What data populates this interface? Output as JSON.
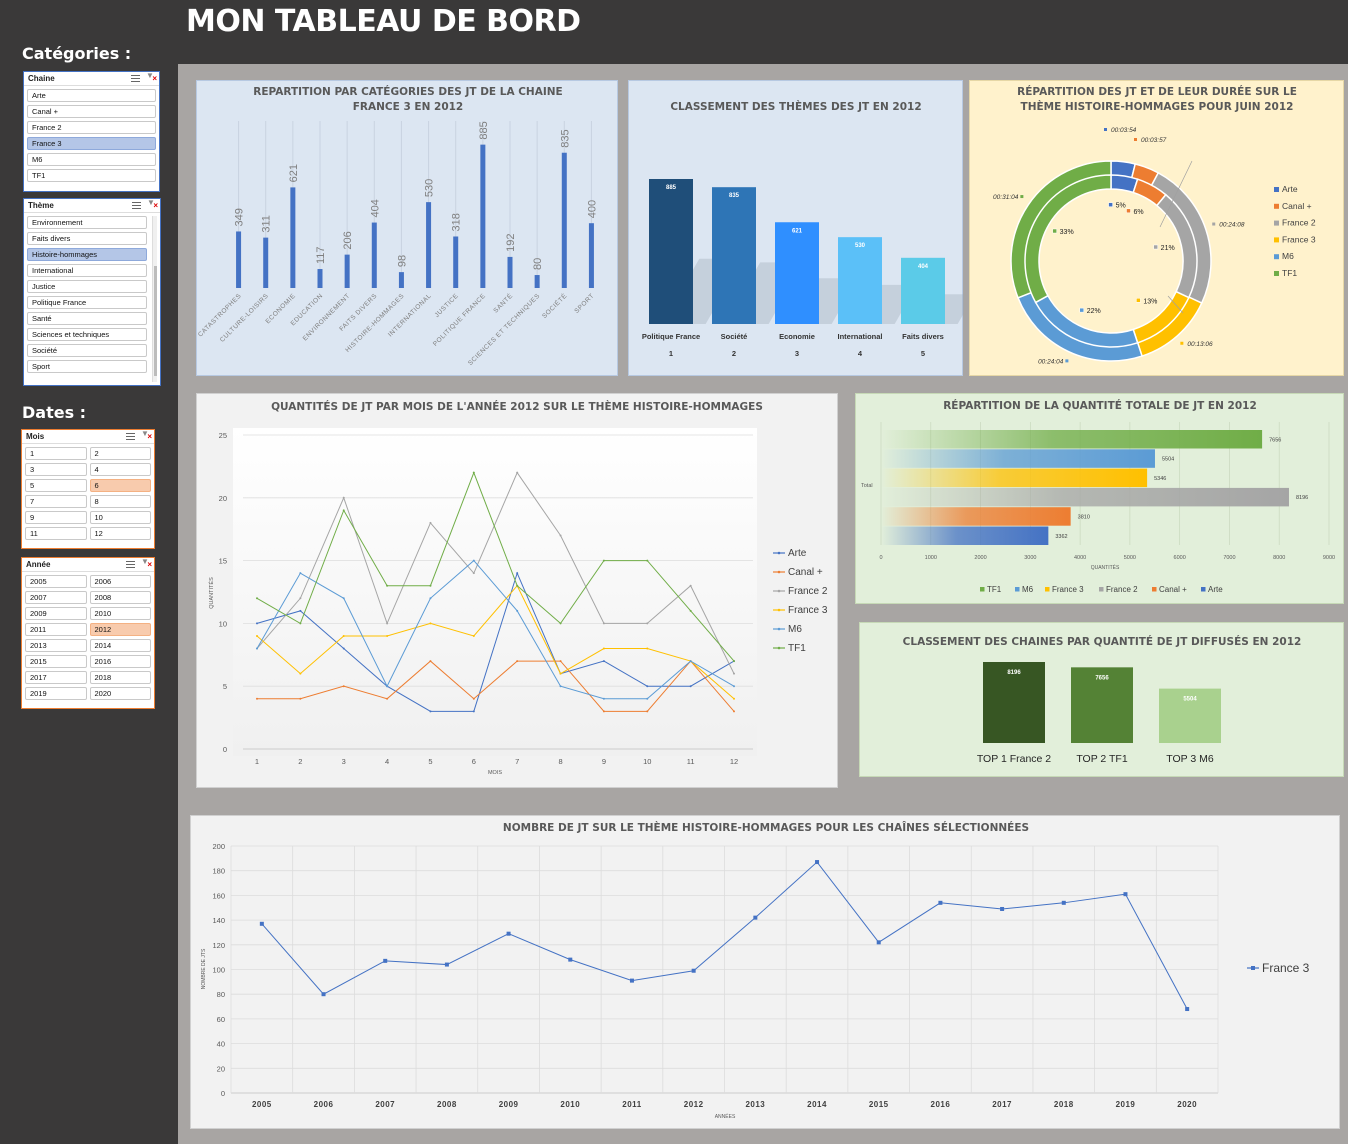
{
  "dashboard": {
    "title": "MON TABLEAU DE BORD"
  },
  "sidebar": {
    "categories_label": "Catégories :",
    "dates_label": "Dates :",
    "chaine": {
      "title": "Chaine",
      "items": [
        "Arte",
        "Canal +",
        "France 2",
        "France 3",
        "M6",
        "TF1"
      ],
      "selected": "France 3"
    },
    "theme": {
      "title": "Thème",
      "items": [
        "Environnement",
        "Faits divers",
        "Histoire-hommages",
        "International",
        "Justice",
        "Politique France",
        "Santé",
        "Sciences et techniques",
        "Société",
        "Sport"
      ],
      "selected": "Histoire-hommages"
    },
    "mois": {
      "title": "Mois",
      "items": [
        "1",
        "2",
        "3",
        "4",
        "5",
        "6",
        "7",
        "8",
        "9",
        "10",
        "11",
        "12"
      ],
      "selected": "6"
    },
    "annee": {
      "title": "Année",
      "items": [
        "2005",
        "2006",
        "2007",
        "2008",
        "2009",
        "2010",
        "2011",
        "2012",
        "2013",
        "2014",
        "2015",
        "2016",
        "2017",
        "2018",
        "2019",
        "2020"
      ],
      "selected": "2012"
    }
  },
  "colors": {
    "background": "#3a3939",
    "canvas": "#a8a5a3",
    "blue": "#4472c4",
    "orange": "#ed7d31",
    "gray": "#a5a5a5",
    "yellow": "#ffc000",
    "m6": "#5b9bd5",
    "green": "#70ad47",
    "panel_blue": "#dce6f2",
    "panel_yellow": "#fff2cc",
    "panel_green": "#e2efda"
  },
  "chart_data": [
    {
      "id": "categories",
      "type": "bar",
      "title": "REPARTITION PAR CATÉGORIES DES JT DE LA CHAINE FRANCE 3 EN 2012",
      "categories": [
        "CATASTROPHES",
        "CULTURE-LOISIRS",
        "ECONOMIE",
        "EDUCATION",
        "ENVIRONNEMENT",
        "FAITS DIVERS",
        "HISTOIRE-HOMMAGES",
        "INTERNATIONAL",
        "JUSTICE",
        "POLITIQUE FRANCE",
        "SANTÉ",
        "SCIENCES ET TECHNIQUES",
        "SOCIÉTÉ",
        "SPORT"
      ],
      "values": [
        349,
        311,
        621,
        117,
        206,
        404,
        98,
        530,
        318,
        885,
        192,
        80,
        835,
        400
      ],
      "ylim": [
        0,
        1000
      ],
      "bar_color": "#4472c4"
    },
    {
      "id": "themes_rank",
      "type": "bar",
      "title": "CLASSEMENT DES THÈMES DES JT EN 2012",
      "categories": [
        "Politique France",
        "Société",
        "Economie",
        "International",
        "Faits divers"
      ],
      "ranks": [
        "1",
        "2",
        "3",
        "4",
        "5"
      ],
      "values": [
        885,
        835,
        621,
        530,
        404
      ],
      "colors": [
        "#1f4e79",
        "#2e75b6",
        "#2f8fff",
        "#5bc0f8",
        "#5bcbe8"
      ]
    },
    {
      "id": "donut",
      "type": "pie",
      "title": "RÉPARTITION DES JT ET DE LEUR DURÉE SUR LE THÈME HISTOIRE-HOMMAGES POUR JUIN 2012",
      "legend": [
        "Arte",
        "Canal +",
        "France 2",
        "France 3",
        "M6",
        "TF1"
      ],
      "legend_position": "right",
      "colors": [
        "#4472c4",
        "#ed7d31",
        "#a5a5a5",
        "#ffc000",
        "#5b9bd5",
        "#70ad47"
      ],
      "inner_percent": [
        5,
        6,
        21,
        13,
        22,
        33
      ],
      "inner_labels": [
        "5%",
        "6%",
        "21%",
        "13%",
        "22%",
        "33%"
      ],
      "outer_durations": [
        "00:03:54",
        "00:03:57",
        "00:24:08",
        "00:13:06",
        "00:24:04",
        "00:31:04"
      ],
      "outer_minutes": [
        3.9,
        3.95,
        24.13,
        13.1,
        24.07,
        31.07
      ]
    },
    {
      "id": "monthly",
      "type": "line",
      "title": "QUANTITÉS DE JT PAR MOIS DE L'ANNÉE 2012 SUR LE THÈME HISTOIRE-HOMMAGES",
      "xlabel": "MOIS",
      "ylabel": "QUANTITÉS",
      "x": [
        1,
        2,
        3,
        4,
        5,
        6,
        7,
        8,
        9,
        10,
        11,
        12
      ],
      "ylim": [
        0,
        25
      ],
      "yticks": [
        0,
        5,
        10,
        15,
        20,
        25
      ],
      "legend_position": "right",
      "series": [
        {
          "name": "Arte",
          "color": "#4472c4",
          "values": [
            10,
            11,
            8,
            5,
            3,
            3,
            14,
            6,
            7,
            5,
            5,
            7
          ]
        },
        {
          "name": "Canal +",
          "color": "#ed7d31",
          "values": [
            4,
            4,
            5,
            4,
            7,
            4,
            7,
            7,
            3,
            3,
            7,
            3
          ]
        },
        {
          "name": "France 2",
          "color": "#a5a5a5",
          "values": [
            8,
            12,
            20,
            10,
            18,
            14,
            22,
            17,
            10,
            10,
            13,
            6
          ]
        },
        {
          "name": "France 3",
          "color": "#ffc000",
          "values": [
            9,
            6,
            9,
            9,
            10,
            9,
            13,
            6,
            8,
            8,
            7,
            4
          ]
        },
        {
          "name": "M6",
          "color": "#5b9bd5",
          "values": [
            8,
            14,
            12,
            5,
            12,
            15,
            11,
            5,
            4,
            4,
            7,
            5
          ]
        },
        {
          "name": "TF1",
          "color": "#70ad47",
          "values": [
            12,
            10,
            19,
            13,
            13,
            22,
            13,
            10,
            15,
            15,
            11,
            7
          ]
        }
      ]
    },
    {
      "id": "total",
      "type": "bar",
      "orientation": "horizontal",
      "title": "RÉPARTITION DE LA QUANTITÉ TOTALE DE JT EN 2012",
      "category": "Total",
      "xlabel": "QUANTITÉS",
      "xlim": [
        0,
        9000
      ],
      "xticks": [
        0,
        1000,
        2000,
        3000,
        4000,
        5000,
        6000,
        7000,
        8000,
        9000
      ],
      "legend_position": "bottom",
      "series": [
        {
          "name": "TF1",
          "color": "#70ad47",
          "value": 7656
        },
        {
          "name": "M6",
          "color": "#5b9bd5",
          "value": 5504
        },
        {
          "name": "France 3",
          "color": "#ffc000",
          "value": 5346
        },
        {
          "name": "France 2",
          "color": "#a5a5a5",
          "value": 8196
        },
        {
          "name": "Canal +",
          "color": "#ed7d31",
          "value": 3810
        },
        {
          "name": "Arte",
          "color": "#4472c4",
          "value": 3362
        }
      ]
    },
    {
      "id": "top_channels",
      "type": "bar",
      "title": "CLASSEMENT DES CHAINES PAR QUANTITÉ DE JT DIFFUSÉS EN 2012",
      "categories": [
        "TOP 1 France 2",
        "TOP 2 TF1",
        "TOP 3 M6"
      ],
      "values": [
        8196,
        7656,
        5504
      ],
      "colors": [
        "#375623",
        "#548235",
        "#a9d18e"
      ]
    },
    {
      "id": "yearly",
      "type": "line",
      "title": "NOMBRE DE JT SUR LE THÈME HISTOIRE-HOMMAGES POUR LES CHAÎNES SÉLECTIONNÉES",
      "xlabel": "ANNÉES",
      "ylabel": "NOMBRE DE JTS",
      "x": [
        "2005",
        "2006",
        "2007",
        "2008",
        "2009",
        "2010",
        "2011",
        "2012",
        "2013",
        "2014",
        "2015",
        "2016",
        "2017",
        "2018",
        "2019",
        "2020"
      ],
      "ylim": [
        0,
        200
      ],
      "yticks": [
        0,
        20,
        40,
        60,
        80,
        100,
        120,
        140,
        160,
        180,
        200
      ],
      "legend_position": "right",
      "series": [
        {
          "name": "France 3",
          "color": "#4472c4",
          "values": [
            137,
            80,
            107,
            104,
            129,
            108,
            91,
            99,
            142,
            187,
            122,
            154,
            149,
            154,
            161,
            68
          ]
        }
      ]
    }
  ]
}
